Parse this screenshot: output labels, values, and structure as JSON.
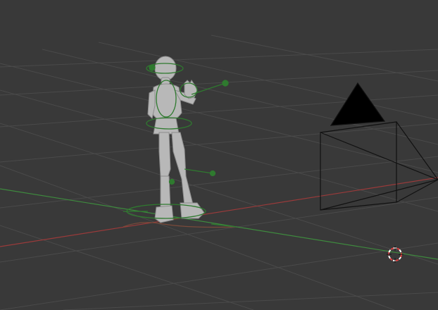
{
  "viewport": {
    "background": "#393939",
    "grid_color": "#4a4a4a",
    "x_axis_color": "#9a3a3a",
    "y_axis_color": "#3e8a3e"
  },
  "scene": {
    "character": {
      "icon": "humanoid-figure",
      "mesh_color": "#b8b8b8"
    },
    "rig_controls": {
      "icon": "armature-controls",
      "color": "#2f7a2f"
    },
    "camera": {
      "icon": "camera-object",
      "line_color": "#111111"
    },
    "cursor_3d": {
      "icon": "3d-cursor-icon",
      "colors": [
        "#e04040",
        "#ffffff"
      ]
    }
  }
}
